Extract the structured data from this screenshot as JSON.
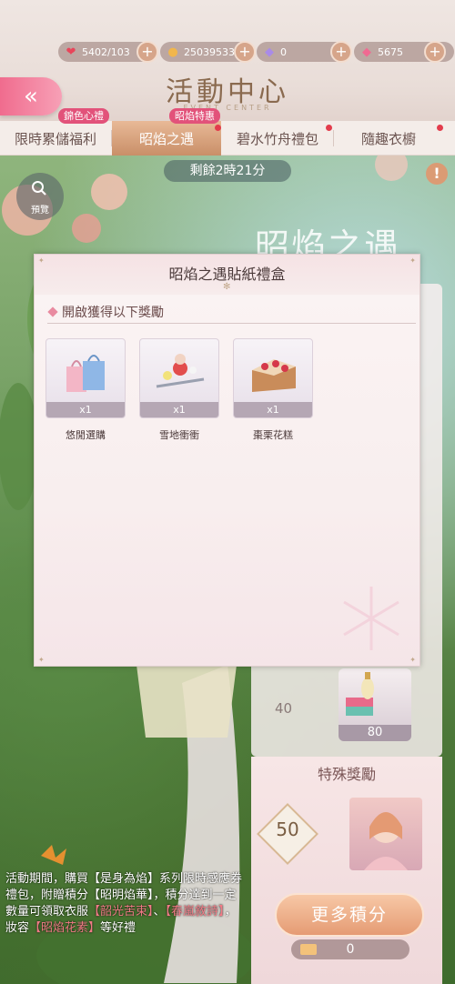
{
  "resources": [
    {
      "icon": "heart-icon",
      "value": "5402/103"
    },
    {
      "icon": "coin-icon",
      "value": "25039533"
    },
    {
      "icon": "diamond-icon",
      "value": "0"
    },
    {
      "icon": "gem-icon",
      "value": "5675"
    }
  ],
  "header": {
    "title": "活動中心",
    "subtitle": "EVENT CENTER"
  },
  "tabs": [
    {
      "label": "限時累儲福利",
      "badge": "錦色心禮",
      "active": false,
      "dot": false
    },
    {
      "label": "昭焰之遇",
      "badge": "昭焰特惠",
      "active": true,
      "dot": true
    },
    {
      "label": "碧水竹舟禮包",
      "badge": "",
      "active": false,
      "dot": true
    },
    {
      "label": "隨趣衣櫥",
      "badge": "",
      "active": false,
      "dot": true
    }
  ],
  "timer": "剩餘2時21分",
  "preview_label": "預覽",
  "event_banner": "昭焰之遇",
  "modal": {
    "title": "昭焰之遇貼紙禮盒",
    "section": "開啟獲得以下獎勵",
    "items": [
      {
        "name": "悠閒選購",
        "qty": "x1",
        "icon": "shopping-bags-icon"
      },
      {
        "name": "雪地衝衝",
        "qty": "x1",
        "icon": "snow-sled-icon"
      },
      {
        "name": "棗栗花糕",
        "qty": "x1",
        "icon": "cake-icon"
      }
    ]
  },
  "rewards": {
    "milestone": "40",
    "item_value": "80",
    "special_title": "特殊獎勵",
    "special_value": "50"
  },
  "more_points": "更多積分",
  "points": "0",
  "description": {
    "part1": "活動期間，購買【是身為焰】系列限時感應券禮包，附贈積分【昭明焰華】，積分達到一定數量可領取衣服",
    "hl1": "【韶光苦束】",
    "sep": "、",
    "hl2": "【春嵐敘詩】",
    "part2": "，妝容",
    "hl3": "【昭焰花素】",
    "part3": "等好禮"
  }
}
